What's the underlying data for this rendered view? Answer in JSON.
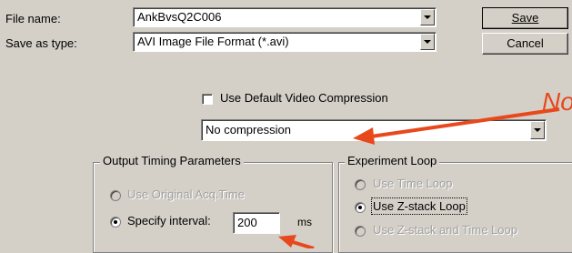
{
  "file_name": {
    "label": "File name:",
    "value": "AnkBvsQ2C006"
  },
  "save_as_type": {
    "label": "Save as type:",
    "value": "AVI Image File Format (*.avi)"
  },
  "buttons": {
    "save": "Save",
    "cancel": "Cancel"
  },
  "video": {
    "use_default_label": "Use Default Video Compression",
    "use_default_checked": false,
    "compression_value": "No compression"
  },
  "output_timing": {
    "title": "Output Timing Parameters",
    "use_original_label": "Use Original Acq.Time",
    "specify_interval_label": "Specify interval:",
    "interval_value": "200",
    "unit": "ms",
    "selected": "specify_interval"
  },
  "experiment_loop": {
    "title": "Experiment Loop",
    "use_time_loop": "Use Time Loop",
    "use_z_stack": "Use Z-stack Loop",
    "use_z_stack_and_time": "Use Z-stack and Time Loop",
    "selected": "use_z_stack"
  },
  "annotation": {
    "text": "No",
    "color": "#e8481c"
  },
  "icons": {
    "dropdown": "chevron-down-icon"
  }
}
